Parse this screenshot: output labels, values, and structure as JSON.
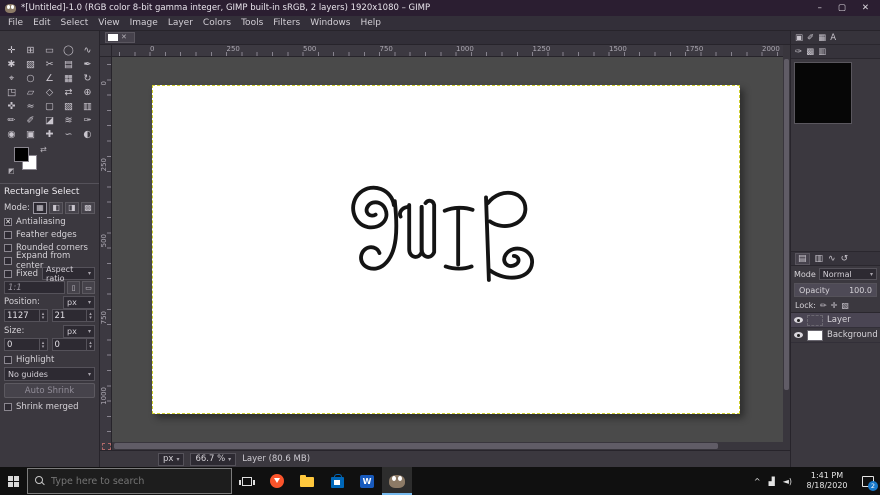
{
  "window": {
    "title": "*[Untitled]-1.0 (RGB color 8-bit gamma integer, GIMP built-in sRGB, 2 layers) 1920x1080 – GIMP",
    "minimize": "–",
    "maximize": "▢",
    "close": "✕",
    "tab_close": "✕"
  },
  "menu": {
    "items": [
      "File",
      "Edit",
      "Select",
      "View",
      "Image",
      "Layer",
      "Colors",
      "Tools",
      "Filters",
      "Windows",
      "Help"
    ]
  },
  "toolbox": {
    "tools": [
      {
        "name": "move-tool",
        "glyph": "✛"
      },
      {
        "name": "align-tool",
        "glyph": "⊞"
      },
      {
        "name": "rectangle-select-tool",
        "glyph": "▭"
      },
      {
        "name": "ellipse-select-tool",
        "glyph": "◯"
      },
      {
        "name": "free-select-tool",
        "glyph": "∿"
      },
      {
        "name": "fuzzy-select-tool",
        "glyph": "✱"
      },
      {
        "name": "select-by-color-tool",
        "glyph": "▧"
      },
      {
        "name": "scissors-select-tool",
        "glyph": "✂"
      },
      {
        "name": "foreground-select-tool",
        "glyph": "▤"
      },
      {
        "name": "paths-tool",
        "glyph": "✒"
      },
      {
        "name": "color-picker-tool",
        "glyph": "⌖"
      },
      {
        "name": "zoom-tool",
        "glyph": "○"
      },
      {
        "name": "measure-tool",
        "glyph": "∠"
      },
      {
        "name": "crop-tool",
        "glyph": "▦"
      },
      {
        "name": "rotate-tool",
        "glyph": "↻"
      },
      {
        "name": "scale-tool",
        "glyph": "◳"
      },
      {
        "name": "shear-tool",
        "glyph": "▱"
      },
      {
        "name": "perspective-tool",
        "glyph": "◇"
      },
      {
        "name": "flip-tool",
        "glyph": "⇄"
      },
      {
        "name": "unified-transform-tool",
        "glyph": "⊕"
      },
      {
        "name": "handle-transform-tool",
        "glyph": "✜"
      },
      {
        "name": "warp-tool",
        "glyph": "≈"
      },
      {
        "name": "cage-transform-tool",
        "glyph": "▢"
      },
      {
        "name": "bucket-fill-tool",
        "glyph": "▨"
      },
      {
        "name": "gradient-tool",
        "glyph": "▥"
      },
      {
        "name": "pencil-tool",
        "glyph": "✏"
      },
      {
        "name": "paintbrush-tool",
        "glyph": "✐"
      },
      {
        "name": "eraser-tool",
        "glyph": "◪"
      },
      {
        "name": "airbrush-tool",
        "glyph": "≋"
      },
      {
        "name": "ink-tool",
        "glyph": "✑"
      },
      {
        "name": "mypaint-brush-tool",
        "glyph": "◉"
      },
      {
        "name": "clone-tool",
        "glyph": "▣"
      },
      {
        "name": "heal-tool",
        "glyph": "✚"
      },
      {
        "name": "smudge-tool",
        "glyph": "∽"
      },
      {
        "name": "dodge-burn-tool",
        "glyph": "◐"
      }
    ],
    "swap_icon": "⇄",
    "reset_icon": "◩"
  },
  "tool_options": {
    "title": "Rectangle Select",
    "mode_label": "Mode:",
    "mode_buttons": [
      {
        "name": "mode-replace-button",
        "glyph": "▦",
        "active": true
      },
      {
        "name": "mode-add-button",
        "glyph": "◧"
      },
      {
        "name": "mode-subtract-button",
        "glyph": "◨"
      },
      {
        "name": "mode-intersect-button",
        "glyph": "▩"
      }
    ],
    "checkboxes": [
      {
        "name": "antialiasing-checkbox",
        "label": "Antialiasing",
        "checked": true
      },
      {
        "name": "feather-edges-checkbox",
        "label": "Feather edges",
        "checked": false
      },
      {
        "name": "rounded-corners-checkbox",
        "label": "Rounded corners",
        "checked": false
      },
      {
        "name": "expand-from-center-checkbox",
        "label": "Expand from center",
        "checked": false
      }
    ],
    "fixed_label": "Fixed",
    "fixed_dropdown": "Aspect ratio",
    "ratio_value": "1:1",
    "ratio_buttons": [
      {
        "name": "portrait-orientation-button",
        "glyph": "▯"
      },
      {
        "name": "landscape-orientation-button",
        "glyph": "▭"
      }
    ],
    "position_label": "Position:",
    "position_unit": "px",
    "position_x": "1127",
    "position_y": "21",
    "size_label": "Size:",
    "size_unit": "px",
    "size_w": "0",
    "size_h": "0",
    "highlight": {
      "label": "Highlight",
      "checked": false
    },
    "guides_value": "No guides",
    "auto_shrink_label": "Auto Shrink",
    "shrink_merged": {
      "label": "Shrink merged",
      "checked": false
    },
    "caret": "▾"
  },
  "canvas": {
    "ruler_top": [
      "0",
      "250",
      "500",
      "750",
      "1000",
      "1250",
      "1500",
      "1750",
      "2000"
    ],
    "ruler_left": [
      "0",
      "250",
      "500",
      "750",
      "1000"
    ]
  },
  "statusbar": {
    "unit": "px",
    "zoom": "66.7 %",
    "message": "Layer (80.6 MB)",
    "caret": "▾"
  },
  "dock": {
    "top_icons": [
      {
        "name": "image-dock-icon",
        "glyph": "▣"
      },
      {
        "name": "brushes-dock-icon",
        "glyph": "✐"
      },
      {
        "name": "patterns-dock-icon",
        "glyph": "▦"
      },
      {
        "name": "fonts-dock-icon",
        "glyph": "A"
      }
    ],
    "sub_icons": [
      {
        "name": "brush-editor-icon",
        "glyph": "✑"
      },
      {
        "name": "pattern-preview-icon",
        "glyph": "▩"
      },
      {
        "name": "gradient-preview-icon",
        "glyph": "▥"
      }
    ],
    "collapse_icon": "◂",
    "dialog_tabs": [
      {
        "name": "layers-tab-icon",
        "glyph": "▤",
        "active": true
      },
      {
        "name": "channels-tab-icon",
        "glyph": "▥"
      },
      {
        "name": "paths-tab-icon",
        "glyph": "∿"
      },
      {
        "name": "history-tab-icon",
        "glyph": "↺"
      }
    ],
    "mode_label": "Mode",
    "mode_value": "Normal",
    "mode_caret": "▾",
    "opacity_label": "Opacity",
    "opacity_value": "100.0",
    "lock_label": "Lock:",
    "lock_icons": [
      {
        "name": "lock-pixels-icon",
        "glyph": "✏"
      },
      {
        "name": "lock-position-icon",
        "glyph": "✛"
      },
      {
        "name": "lock-alpha-icon",
        "glyph": "▧"
      }
    ],
    "layers": [
      {
        "name": "Layer",
        "thumb": "empty",
        "selected": true
      },
      {
        "name": "Background",
        "thumb": "white"
      }
    ]
  },
  "taskbar": {
    "search": {
      "placeholder": "Type here to search"
    },
    "word_letter": "W",
    "tray": [
      {
        "name": "tray-expand-icon",
        "glyph": "^"
      },
      {
        "name": "network-icon",
        "glyph": "▟"
      },
      {
        "name": "volume-icon",
        "glyph": "◄)"
      }
    ],
    "clock": {
      "time": "1:41 PM",
      "date": "8/18/2020"
    },
    "action_center_badge": "2"
  }
}
